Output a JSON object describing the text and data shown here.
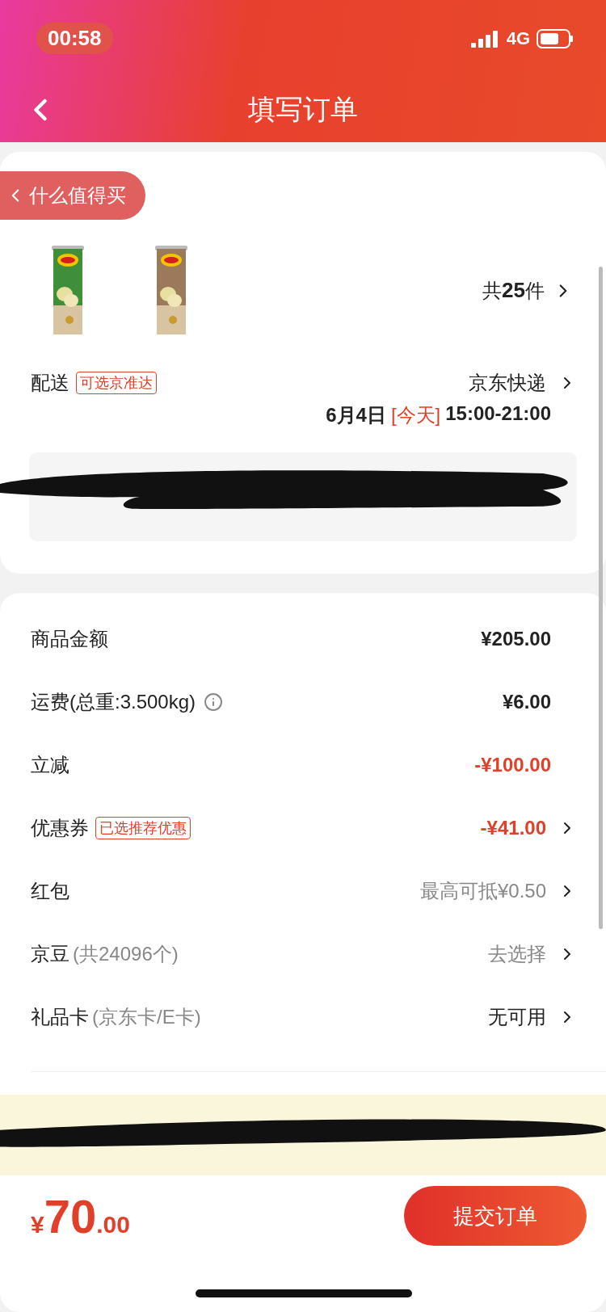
{
  "status_bar": {
    "time": "00:58",
    "network": "4G"
  },
  "nav": {
    "title": "填写订单"
  },
  "back_pill": {
    "label": "什么值得买"
  },
  "products": {
    "count": "共**25**件"
  },
  "delivery": {
    "label": "配送",
    "tag": "可选京准达",
    "carrier": "京东快递",
    "date": "6月4日",
    "day": "[今天]",
    "time": "15:00-21:00"
  },
  "fees": [
    {
      "label": "商品金额",
      "value": "¥205.00",
      "kind": "bold",
      "arrow": false
    },
    {
      "label": "运费(总重:3.500kg)",
      "info": true,
      "value": "¥6.00",
      "kind": "bold",
      "arrow": false
    },
    {
      "label": "立减",
      "value": "-¥100.00",
      "kind": "red",
      "arrow": false
    },
    {
      "label": "优惠券",
      "tag": "已选推荐优惠",
      "value": "-¥41.00",
      "kind": "red",
      "arrow": true
    },
    {
      "label": "红包",
      "value": "最高可抵¥0.50",
      "kind": "grey",
      "arrow": true
    },
    {
      "label": "京豆",
      "note": "(共24096个)",
      "value": "去选择",
      "kind": "grey",
      "arrow": true
    },
    {
      "label": "礼品卡",
      "note": "(京东卡/E卡)",
      "value": "无可用",
      "kind": "plain",
      "arrow": true
    }
  ],
  "footer": {
    "currency": "¥",
    "amount": "70",
    "decimals": ".00",
    "submit": "提交订单"
  }
}
